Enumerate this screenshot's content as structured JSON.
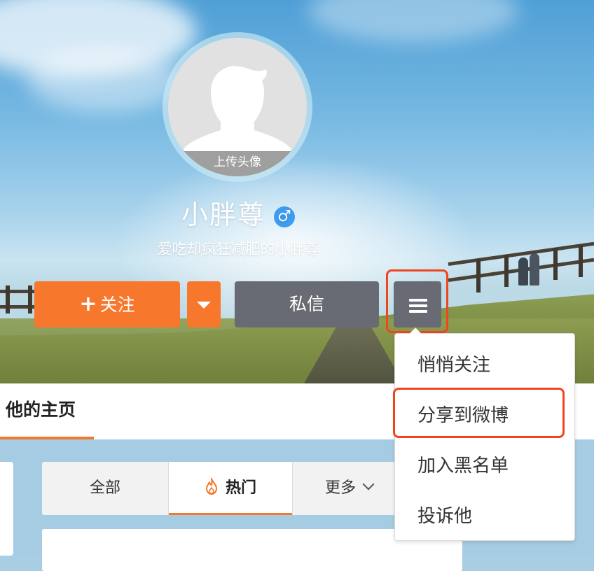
{
  "profile": {
    "name": "小胖尊",
    "gender_symbol": "♂",
    "bio": "爱吃却疯狂减肥的小胖尊",
    "upload_avatar_label": "上传头像"
  },
  "actions": {
    "follow_plus": "+",
    "follow_label": "关注",
    "message_label": "私信"
  },
  "tabbar": {
    "home_tab": "他的主页"
  },
  "filter_tabs": [
    {
      "label": "全部"
    },
    {
      "label": "热门",
      "icon": "flame-icon"
    },
    {
      "label": "更多",
      "icon": "chevron-down-icon"
    }
  ],
  "dropdown_menu": {
    "items": [
      {
        "label": "悄悄关注"
      },
      {
        "label": "分享到微博",
        "highlighted": true
      },
      {
        "label": "加入黑名单"
      },
      {
        "label": "投诉他"
      }
    ]
  },
  "colors": {
    "accent_orange": "#f7772c",
    "button_gray": "#686a74",
    "highlight_red": "#f0461e",
    "gender_blue": "#3b9cf0"
  }
}
